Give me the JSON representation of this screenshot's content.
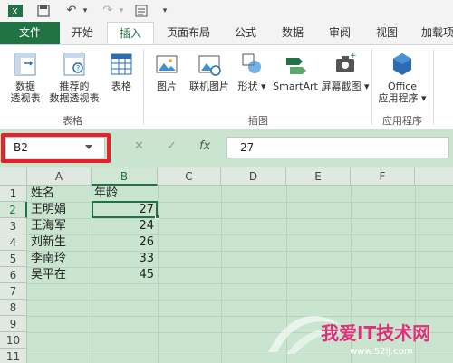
{
  "quick_access": {
    "save_icon": "save-icon",
    "undo_icon": "undo-icon",
    "redo_icon": "redo-icon",
    "form_icon": "form-icon"
  },
  "tabs": [
    {
      "label": "文件"
    },
    {
      "label": "开始"
    },
    {
      "label": "插入"
    },
    {
      "label": "页面布局"
    },
    {
      "label": "公式"
    },
    {
      "label": "数据"
    },
    {
      "label": "审阅"
    },
    {
      "label": "视图"
    },
    {
      "label": "加载项"
    }
  ],
  "ribbon": {
    "buttons": [
      {
        "line1": "数据",
        "line2": "透视表"
      },
      {
        "line1": "推荐的",
        "line2": "数据透视表"
      },
      {
        "line1": "表格",
        "line2": ""
      },
      {
        "line1": "图片",
        "line2": ""
      },
      {
        "line1": "联机图片",
        "line2": ""
      },
      {
        "line1": "形状",
        "line2": ""
      },
      {
        "line1": "SmartArt",
        "line2": ""
      },
      {
        "line1": "屏幕截图",
        "line2": ""
      },
      {
        "line1": "Office",
        "line2": "应用程序"
      }
    ],
    "groups": [
      {
        "label": "表格"
      },
      {
        "label": "插图"
      },
      {
        "label": "应用程序"
      }
    ]
  },
  "formula_bar": {
    "name_box": "B2",
    "cancel_glyph": "✕",
    "enter_glyph": "✓",
    "fx_glyph": "fx",
    "formula": "27"
  },
  "sheet": {
    "columns": [
      "A",
      "B",
      "C",
      "D",
      "E",
      "F"
    ],
    "rows": [
      "1",
      "2",
      "3",
      "4",
      "5",
      "6",
      "7",
      "8",
      "9",
      "10",
      "11"
    ],
    "cells": {
      "a1": "姓名",
      "b1": "年龄",
      "a2": "王明娟",
      "b2": "27",
      "a3": "王海军",
      "b3": "24",
      "a4": "刘新生",
      "b4": "26",
      "a5": "李南玲",
      "b5": "33",
      "a6": "吴平在",
      "b6": "45"
    }
  },
  "watermark": {
    "text": "我爱IT技术网",
    "url": "www.52ij.com"
  },
  "colors": {
    "accent": "#217346",
    "grid_bg": "#c9e4cf",
    "highlight": "#e8202a"
  }
}
